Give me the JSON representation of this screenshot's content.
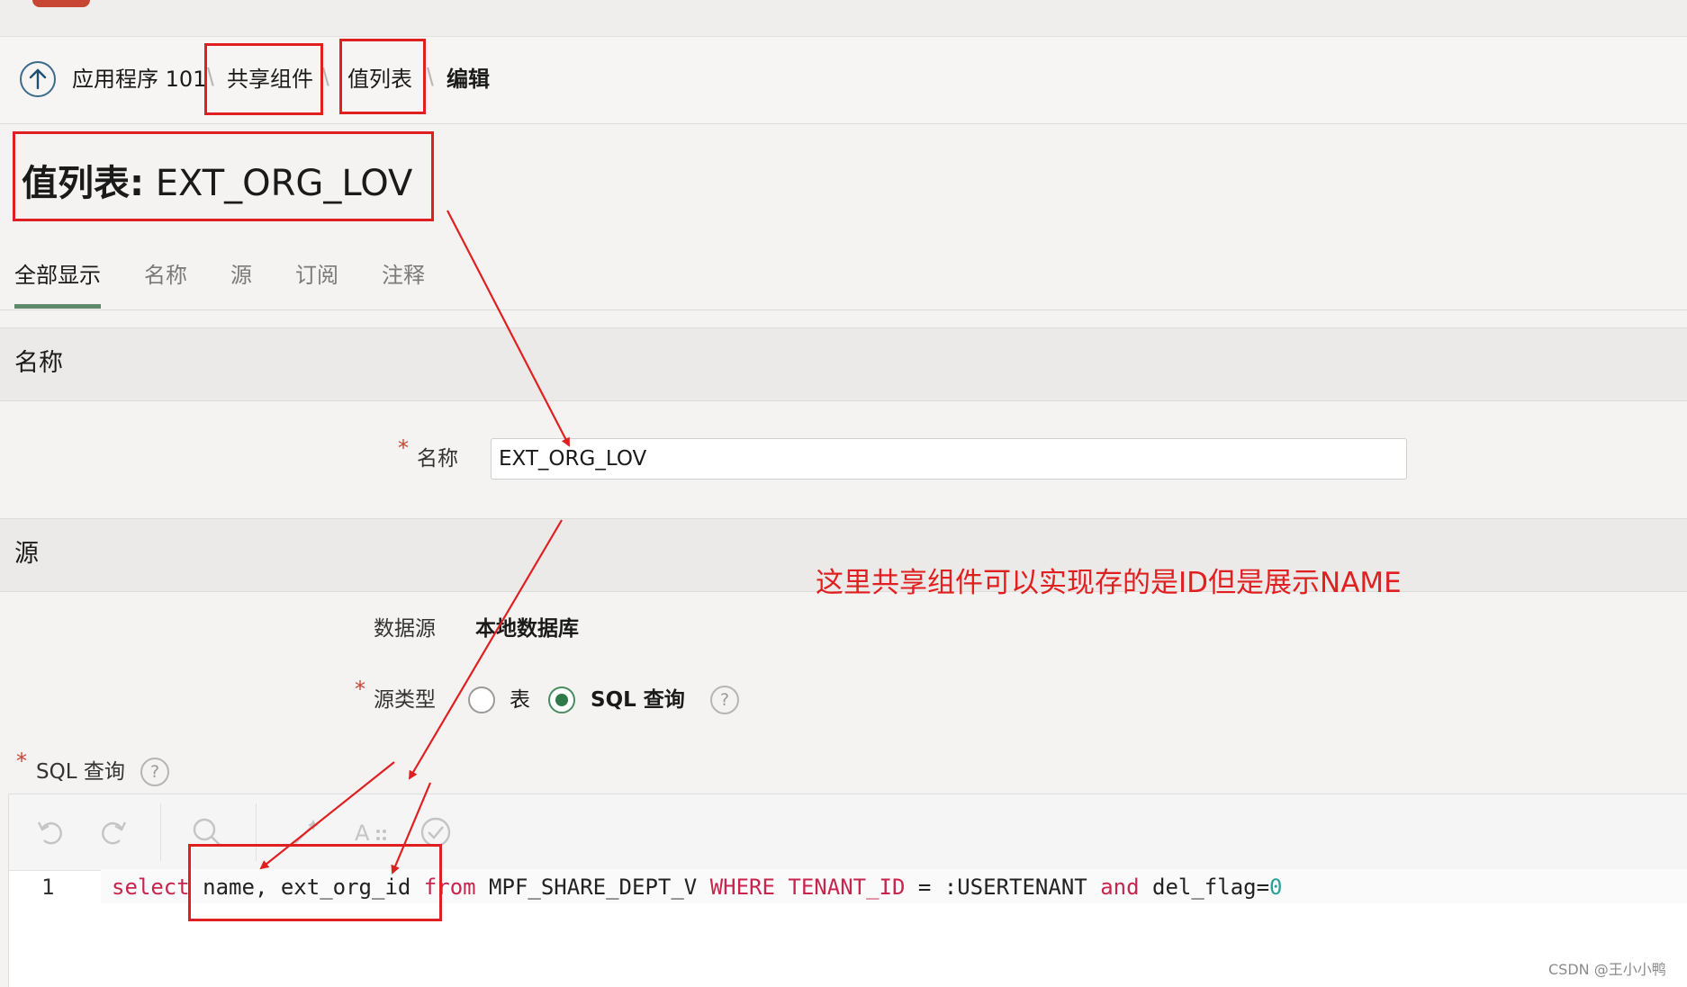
{
  "breadcrumb": {
    "items": [
      "应用程序 101",
      "共享组件",
      "值列表",
      "编辑"
    ]
  },
  "page": {
    "title_label": "值列表:",
    "title_value": "EXT_ORG_LOV"
  },
  "tabs": [
    "全部显示",
    "名称",
    "源",
    "订阅",
    "注释"
  ],
  "sections": {
    "name": {
      "title": "名称",
      "field_label": "名称",
      "field_value": "EXT_ORG_LOV"
    },
    "source": {
      "title": "源",
      "datasource_label": "数据源",
      "datasource_value": "本地数据库",
      "source_type_label": "源类型",
      "option_table": "表",
      "option_sql": "SQL 查询",
      "sql_label": "SQL 查询"
    }
  },
  "editor": {
    "line_number": "1",
    "tokens": [
      "select",
      "name, ext_org_id",
      "from",
      "MPF_SHARE_DEPT_V",
      "WHERE",
      "TENANT_ID",
      " = :USERTENANT ",
      "and",
      " del_flag=",
      "0"
    ]
  },
  "help_glyph": "?",
  "annotation": {
    "text": "这里共享组件可以实现存的是ID但是展示NAME",
    "color": "#e02020"
  },
  "watermark": "CSDN @王小小鸭",
  "colors": {
    "brand_red": "#c74634",
    "active_tab": "#5e8a6b",
    "radio_checked": "#2f7a4a",
    "sql_keyword": "#c7254e"
  }
}
